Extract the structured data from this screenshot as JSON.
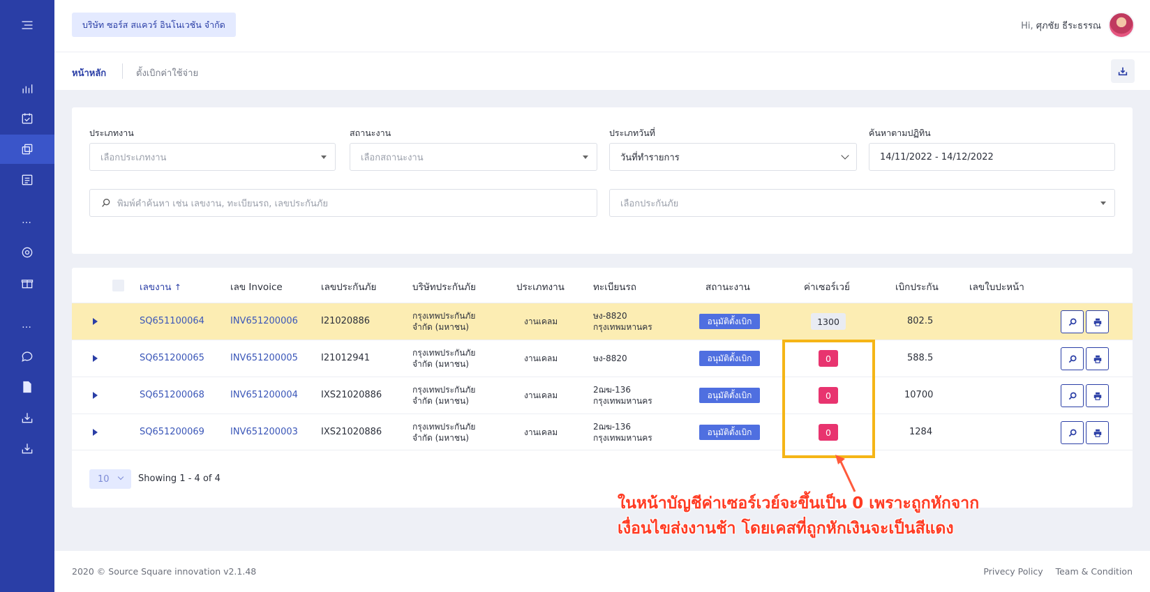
{
  "topbar": {
    "company": "บริษัท ซอร์ส สแควร์ อินโนเวชัน จำกัด",
    "greeting_prefix": "Hi,",
    "user_name": "ศุภชัย ธีระธรรณ"
  },
  "subnav": {
    "home": "หน้าหลัก",
    "current": "ตั้งเบิกค่าใช้จ่าย"
  },
  "filters": {
    "job_type_label": "ประเภทงาน",
    "job_type_placeholder": "เลือกประเภทงาน",
    "job_status_label": "สถานะงาน",
    "job_status_placeholder": "เลือกสถานะงาน",
    "date_type_label": "ประเภทวันที่",
    "date_type_value": "วันที่ทำรายการ",
    "date_range_label": "ค้นหาตามปฏิทิน",
    "date_range_value": "14/11/2022 - 14/12/2022",
    "search_placeholder": "พิมพ์คำค้นหา เช่น เลขงาน, ทะเบียนรถ, เลขประกันภัย",
    "insurer_placeholder": "เลือกประกันภัย"
  },
  "table": {
    "headers": {
      "job_no": "เลขงาน",
      "invoice": "เลข Invoice",
      "policy": "เลขประกันภัย",
      "insurer": "บริษัทประกันภัย",
      "job_type": "ประเภทงาน",
      "plate": "ทะเบียนรถ",
      "status": "สถานะงาน",
      "survey_fee": "ค่าเซอร์เวย์",
      "claim": "เบิกประกัน",
      "cover_no": "เลขใบปะหน้า"
    },
    "rows": [
      {
        "job_no": "SQ651100064",
        "invoice": "INV651200006",
        "policy": "I21020886",
        "insurer_1": "กรุงเทพประกันภัย",
        "insurer_2": "จำกัด (มหาชน)",
        "job_type": "งานเคลม",
        "plate_1": "ษง-8820",
        "plate_2": "กรุงเทพมหานคร",
        "status": "อนุมัติตั้งเบิก",
        "survey_fee": "1300",
        "claim": "802.5",
        "cover_no": ""
      },
      {
        "job_no": "SQ651200065",
        "invoice": "INV651200005",
        "policy": "I21012941",
        "insurer_1": "กรุงเทพประกันภัย",
        "insurer_2": "จำกัด (มหาชน)",
        "job_type": "งานเคลม",
        "plate_1": "ษง-8820",
        "plate_2": "",
        "status": "อนุมัติตั้งเบิก",
        "survey_fee": "0",
        "claim": "588.5",
        "cover_no": ""
      },
      {
        "job_no": "SQ651200068",
        "invoice": "INV651200004",
        "policy": "IXS21020886",
        "insurer_1": "กรุงเทพประกันภัย",
        "insurer_2": "จำกัด (มหาชน)",
        "job_type": "งานเคลม",
        "plate_1": "2ฌฆ-136",
        "plate_2": "กรุงเทพมหานคร",
        "status": "อนุมัติตั้งเบิก",
        "survey_fee": "0",
        "claim": "10700",
        "cover_no": ""
      },
      {
        "job_no": "SQ651200069",
        "invoice": "INV651200003",
        "policy": "IXS21020886",
        "insurer_1": "กรุงเทพประกันภัย",
        "insurer_2": "จำกัด (มหาชน)",
        "job_type": "งานเคลม",
        "plate_1": "2ฌฆ-136",
        "plate_2": "กรุงเทพมหานคร",
        "status": "อนุมัติตั้งเบิก",
        "survey_fee": "0",
        "claim": "1284",
        "cover_no": ""
      }
    ],
    "page_size": "10",
    "showing": "Showing 1 - 4 of 4"
  },
  "annotation": {
    "line1": "ในหน้าบัญชีค่าเซอร์เวย์จะขึ้นเป็น 0 เพราะถูกหักจาก",
    "line2": "เงื่อนไขส่งงานช้า โดยเคสที่ถูกหักเงินจะเป็นสีแดง",
    "color": "#ff3b23",
    "box_color": "#f5b516"
  },
  "footer": {
    "copyright": "2020 © Source Square innovation v2.1.48",
    "privacy": "Privecy Policy",
    "terms": "Team & Condition"
  },
  "colors": {
    "sidebar": "#2a3ea6",
    "highlight_row": "#fcedb3",
    "status_badge": "#4f6fe0",
    "deducted_badge": "#e8346f"
  }
}
